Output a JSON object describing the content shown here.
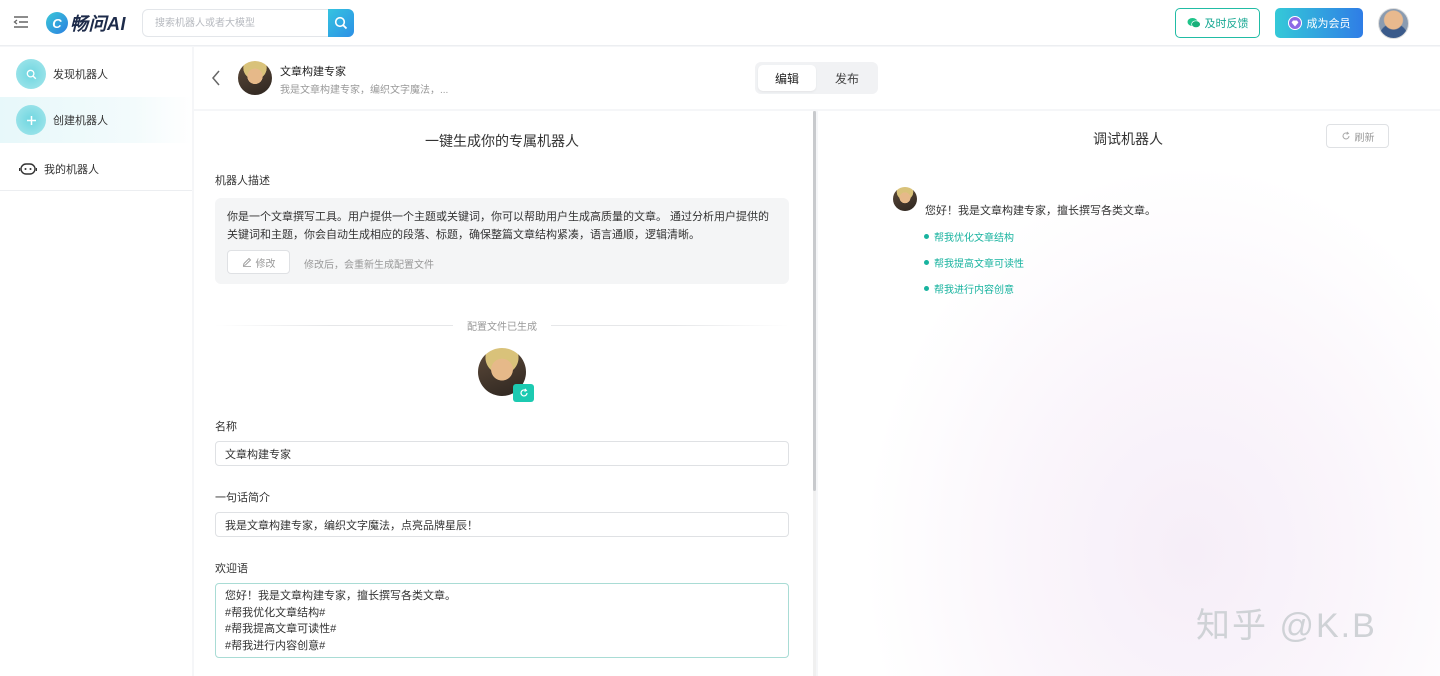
{
  "app": {
    "logo_mark": "C",
    "logo_text": "畅问AI"
  },
  "search": {
    "placeholder": "搜索机器人或者大模型"
  },
  "header": {
    "feedback_label": "及时反馈",
    "member_label": "成为会员"
  },
  "sidebar": {
    "items": [
      {
        "label": "发现机器人",
        "icon": "search-icon"
      },
      {
        "label": "创建机器人",
        "icon": "plus-icon"
      },
      {
        "label": "我的机器人",
        "icon": "robot-icon"
      }
    ]
  },
  "editor": {
    "bot_name": "文章构建专家",
    "bot_sub": "我是文章构建专家，编织文字魔法，...",
    "tabs": [
      {
        "label": "编辑"
      },
      {
        "label": "发布"
      }
    ]
  },
  "form": {
    "panel_title": "一键生成你的专属机器人",
    "desc_label": "机器人描述",
    "desc_text": "你是一个文章撰写工具。用户提供一个主题或关键词，你可以帮助用户生成高质量的文章。 通过分析用户提供的关键词和主题，你会自动生成相应的段落、标题，确保整篇文章结构紧凑，语言通顺，逻辑清晰。",
    "edit_label": "修改",
    "edit_hint": "修改后，会重新生成配置文件",
    "generated_label": "配置文件已生成",
    "name_label": "名称",
    "name_value": "文章构建专家",
    "intro_label": "一句话简介",
    "intro_value": "我是文章构建专家，编织文字魔法，点亮品牌星辰！",
    "welcome_label": "欢迎语",
    "welcome_lines": [
      "您好！我是文章构建专家，擅长撰写各类文章。",
      "#帮我优化文章结构#",
      "#帮我提高文章可读性#",
      "#帮我进行内容创意#"
    ]
  },
  "debug": {
    "title": "调试机器人",
    "refresh_label": "刷新",
    "greeting": "您好！我是文章构建专家，擅长撰写各类文章。",
    "suggestions": [
      "帮我优化文章结构",
      "帮我提高文章可读性",
      "帮我进行内容创意"
    ]
  },
  "watermark": "知乎 @K.B",
  "colors": {
    "accent": "#1ccab1",
    "brand_blue": "#2f7de6",
    "suggestion": "#18b39f"
  }
}
